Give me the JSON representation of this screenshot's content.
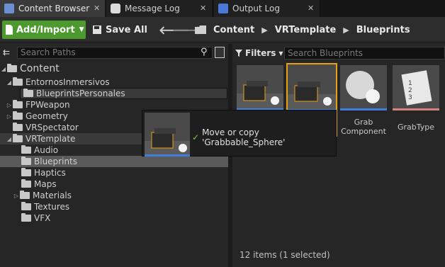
{
  "tabs": [
    {
      "label": "Content Browser",
      "icon": "content-browser-icon"
    },
    {
      "label": "Message Log",
      "icon": "message-log-icon"
    },
    {
      "label": "Output Log",
      "icon": "output-log-icon"
    }
  ],
  "toolbar": {
    "add_import_label": "Add/Import",
    "save_all_label": "Save All",
    "breadcrumbs": [
      "Content",
      "VRTemplate",
      "Blueprints"
    ]
  },
  "sources": {
    "search_placeholder": "Search Paths",
    "tree": [
      {
        "label": "Content"
      },
      {
        "label": "EntornosInmersivos"
      },
      {
        "label": "BlueprintsPersonales"
      },
      {
        "label": "FPWeapon"
      },
      {
        "label": "Geometry"
      },
      {
        "label": "VRSpectator"
      },
      {
        "label": "VRTemplate"
      },
      {
        "label": "Audio"
      },
      {
        "label": "Blueprints"
      },
      {
        "label": "Haptics"
      },
      {
        "label": "Maps"
      },
      {
        "label": "Materials"
      },
      {
        "label": "Textures"
      },
      {
        "label": "VFX"
      }
    ]
  },
  "assets_panel": {
    "filters_label": "Filters",
    "search_placeholder": "Search Blueprints",
    "assets": [
      {
        "label": "",
        "color": "#3f7fd9"
      },
      {
        "label": "",
        "color": "#3f7fd9"
      },
      {
        "label": "Grab Component",
        "color": "#3f7fd9"
      },
      {
        "label": "GrabType",
        "color": "#d98080"
      }
    ],
    "status": "12 items (1 selected)"
  },
  "tooltip": {
    "message": "Move or copy 'Grabbable_Sphere'"
  },
  "colors": {
    "accent_green": "#4c9a2e",
    "selection_orange": "#e5a212",
    "blueprint_blue": "#3f7fd9"
  }
}
